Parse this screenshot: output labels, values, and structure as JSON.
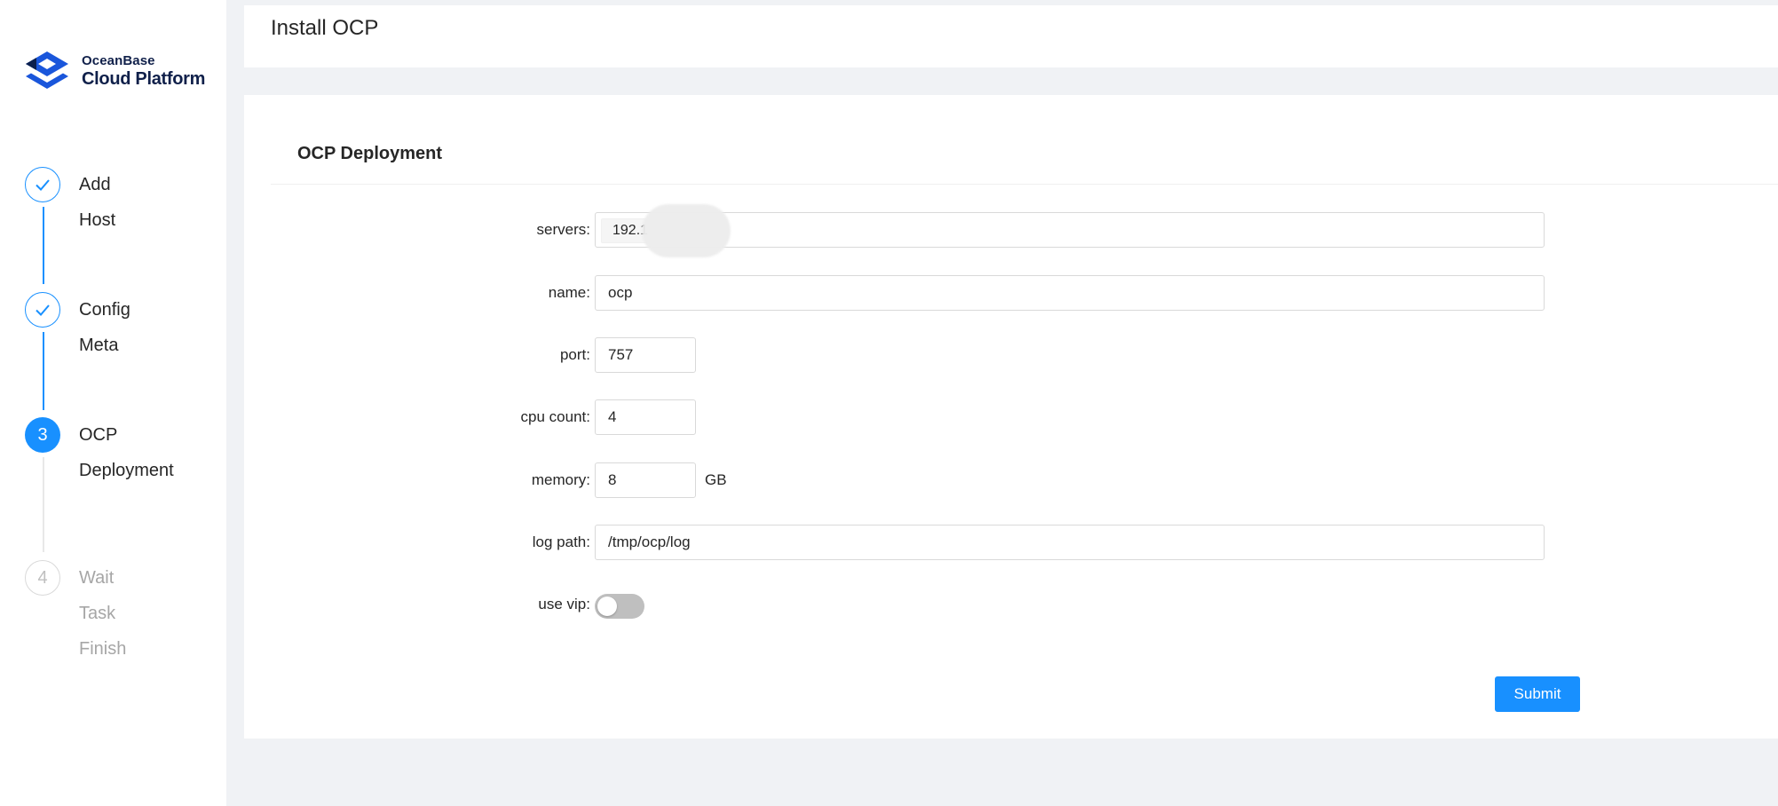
{
  "brand": {
    "line1": "OceanBase",
    "line2": "Cloud Platform",
    "primary_color": "#1890ff",
    "logo_color": "#1a56db"
  },
  "steps": [
    {
      "index": "1",
      "title": "Add Host",
      "status": "finished",
      "icon": "check-icon"
    },
    {
      "index": "2",
      "title": "Config Meta",
      "status": "finished",
      "icon": "check-icon"
    },
    {
      "index": "3",
      "title_line1": "OCP",
      "title_line2": "Deployment",
      "status": "process"
    },
    {
      "index": "4",
      "title": "Wait Task Finish",
      "status": "wait"
    }
  ],
  "header": {
    "title": "Install OCP"
  },
  "form": {
    "card_title": "OCP Deployment",
    "fields": {
      "servers": {
        "label": "servers",
        "tag": "192.1"
      },
      "name": {
        "label": "name",
        "value": "ocp"
      },
      "port": {
        "label": "port",
        "value": "757"
      },
      "cpu_count": {
        "label": "cpu count",
        "value": "4"
      },
      "memory": {
        "label": "memory",
        "value": "8",
        "unit": "GB"
      },
      "log_path": {
        "label": "log path",
        "value": "/tmp/ocp/log"
      },
      "use_vip": {
        "label": "use vip",
        "checked": false
      }
    },
    "colon": ":",
    "submit_label": "Submit"
  }
}
